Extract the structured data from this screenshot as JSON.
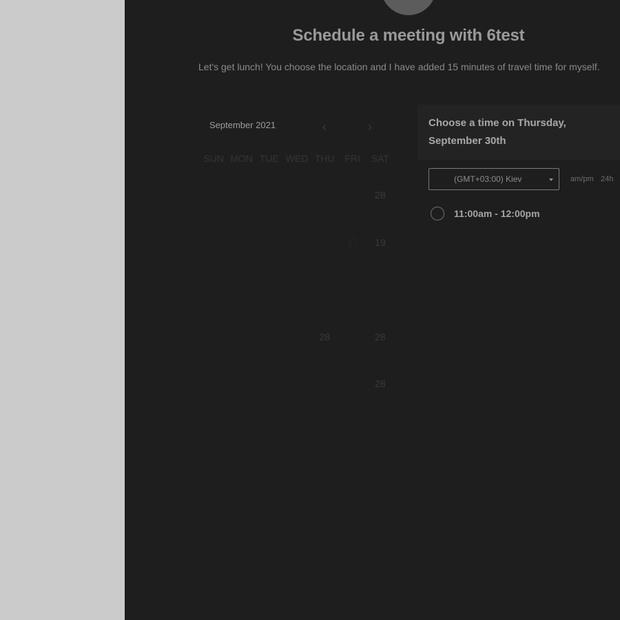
{
  "page": {
    "title": "Schedule a meeting with 6test",
    "description": "Let's get lunch! You choose the location and I have added 15 minutes of travel time for myself."
  },
  "calendar": {
    "month_label": "September 2021",
    "weekdays": [
      "SUN",
      "MON",
      "TUE",
      "WED",
      "THU",
      "FRI",
      "SAT"
    ],
    "weeks": [
      [
        "",
        "",
        "",
        "",
        "",
        "",
        "28"
      ],
      [
        "",
        "",
        "",
        "",
        "",
        "17",
        "19"
      ],
      [
        "",
        "",
        "",
        "",
        "",
        "",
        ""
      ],
      [
        "",
        "",
        "",
        "",
        "28",
        "",
        "28"
      ],
      [
        "",
        "",
        "",
        "",
        "",
        "",
        "28"
      ]
    ]
  },
  "time_picker": {
    "heading": "Choose a time on Thursday, September 30th",
    "timezone": "(GMT+03:00) Kiev",
    "format_ampm": "am/pm",
    "format_24h": "24h",
    "slots": [
      "11:00am - 12:00pm"
    ]
  },
  "colors": {
    "background": "#1e1e1e",
    "sidebar": "#cbcbcb"
  }
}
